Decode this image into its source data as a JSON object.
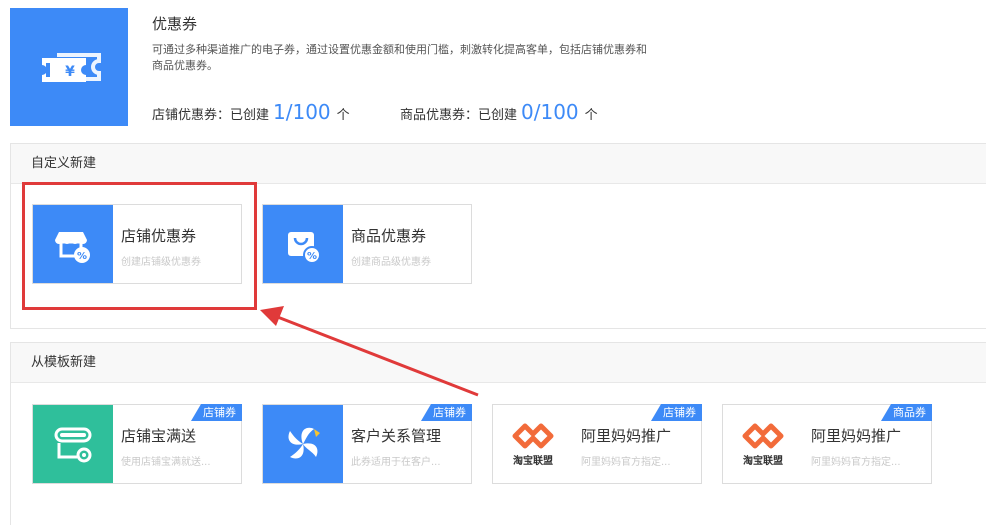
{
  "header": {
    "title": "优惠券",
    "description": "可通过多种渠道推广的电子券，通过设置优惠金额和使用门槛，刺激转化提高客单，包括店铺优惠券和商品优惠券。",
    "shop_stat": {
      "label": "店铺优惠券：已创建",
      "count": "1/100",
      "unit": "个"
    },
    "item_stat": {
      "label": "商品优惠券：已创建",
      "count": "0/100",
      "unit": "个"
    }
  },
  "custom": {
    "title": "自定义新建",
    "cards": [
      {
        "title": "店铺优惠券",
        "subtitle": "创建店铺级优惠券"
      },
      {
        "title": "商品优惠券",
        "subtitle": "创建商品级优惠券"
      }
    ]
  },
  "templates": {
    "title": "从模板新建",
    "cards": [
      {
        "title": "店铺宝满送",
        "subtitle": "使用店铺宝满就送...",
        "badge": "店铺券"
      },
      {
        "title": "客户关系管理",
        "subtitle": "此券适用于在客户...",
        "badge": "店铺券"
      },
      {
        "title": "阿里妈妈推广",
        "subtitle": "阿里妈妈官方指定...",
        "badge": "店铺券",
        "logo_text": "淘宝联盟"
      },
      {
        "title": "阿里妈妈推广",
        "subtitle": "阿里妈妈官方指定...",
        "badge": "商品券",
        "logo_text": "淘宝联盟"
      }
    ]
  },
  "colors": {
    "accent": "#3d8af7",
    "teal": "#2fbf9b",
    "annotation": "#e03a3a",
    "taobao": "#f26b3a"
  },
  "icons": [
    "coupon-ticket-icon",
    "shop-percent-icon",
    "bag-percent-icon",
    "shop-gear-icon",
    "pinwheel-icon",
    "taobao-union-logo"
  ]
}
